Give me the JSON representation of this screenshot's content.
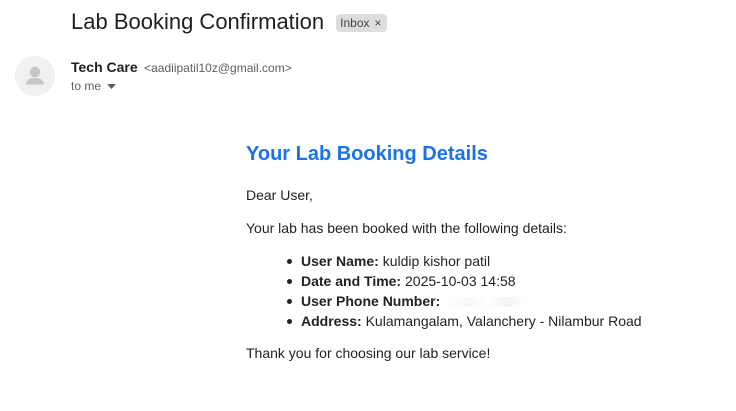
{
  "email": {
    "subject": "Lab Booking Confirmation",
    "label": "Inbox",
    "label_remove": "×",
    "sender_name": "Tech Care",
    "sender_email": "<aadiipatil10z@gmail.com>",
    "recipient": "to me"
  },
  "body": {
    "heading": "Your Lab Booking Details",
    "greeting": "Dear User,",
    "intro": "Your lab has been booked with the following details:",
    "details": [
      {
        "key": "User Name:",
        "value": "kuldip kishor patil"
      },
      {
        "key": "Date and Time:",
        "value": "2025-10-03 14:58"
      },
      {
        "key": "User Phone Number:",
        "value": ""
      },
      {
        "key": "Address:",
        "value": "Kulamangalam, Valanchery - Nilambur Road"
      }
    ],
    "closing": "Thank you for choosing our lab service!"
  },
  "colors": {
    "heading": "#1a73e8",
    "chip_background": "#dddddd",
    "avatar_background": "#f0f0f0"
  },
  "icons": {
    "avatar": "default-person-avatar-icon",
    "recipient_toggle": "caret-down-icon"
  }
}
